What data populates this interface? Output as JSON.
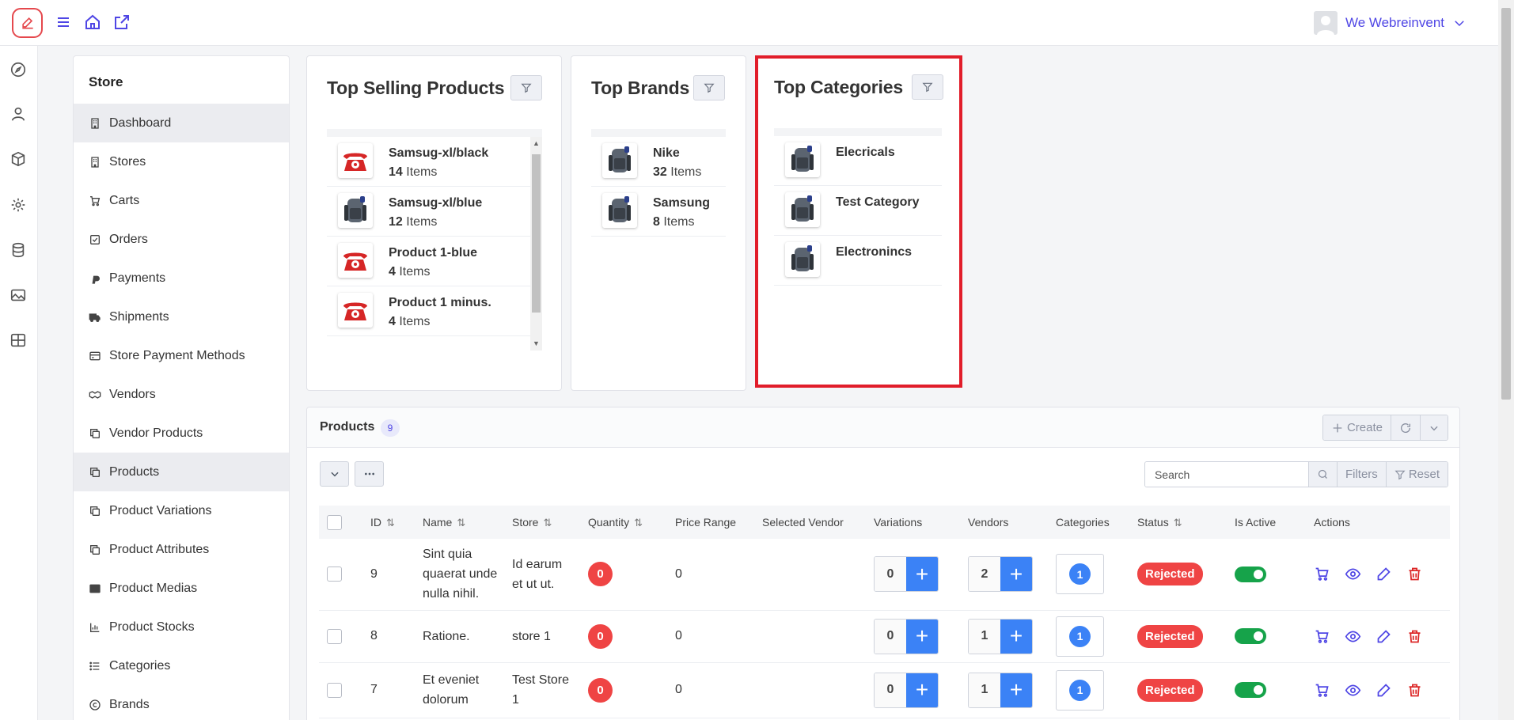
{
  "topbar": {
    "user_name": "We Webreinvent"
  },
  "sidebar": {
    "title": "Store",
    "items": [
      {
        "label": "Dashboard",
        "icon": "building-icon"
      },
      {
        "label": "Stores",
        "icon": "building-icon"
      },
      {
        "label": "Carts",
        "icon": "cart-icon"
      },
      {
        "label": "Orders",
        "icon": "check-square-icon"
      },
      {
        "label": "Payments",
        "icon": "paypal-icon"
      },
      {
        "label": "Shipments",
        "icon": "truck-icon"
      },
      {
        "label": "Store Payment Methods",
        "icon": "credit-card-icon"
      },
      {
        "label": "Vendors",
        "icon": "handshake-icon"
      },
      {
        "label": "Vendor Products",
        "icon": "copy-icon"
      },
      {
        "label": "Products",
        "icon": "copy-icon"
      },
      {
        "label": "Product Variations",
        "icon": "copy-icon"
      },
      {
        "label": "Product Attributes",
        "icon": "copy-icon"
      },
      {
        "label": "Product Medias",
        "icon": "image-icon"
      },
      {
        "label": "Product Stocks",
        "icon": "chart-icon"
      },
      {
        "label": "Categories",
        "icon": "list-icon"
      },
      {
        "label": "Brands",
        "icon": "copyright-icon"
      }
    ]
  },
  "top_selling": {
    "title": "Top Selling Products",
    "items": [
      {
        "name": "Samsug-xl/black",
        "count": "14",
        "unit": "Items",
        "thumb": "phone"
      },
      {
        "name": "Samsug-xl/blue",
        "count": "12",
        "unit": "Items",
        "thumb": "backpack"
      },
      {
        "name": "Product 1-blue",
        "count": "4",
        "unit": "Items",
        "thumb": "phone"
      },
      {
        "name": "Product 1 minus.",
        "count": "4",
        "unit": "Items",
        "thumb": "phone"
      }
    ]
  },
  "top_brands": {
    "title": "Top Brands",
    "items": [
      {
        "name": "Nike",
        "count": "32",
        "unit": "Items"
      },
      {
        "name": "Samsung",
        "count": "8",
        "unit": "Items"
      }
    ]
  },
  "top_categories": {
    "title": "Top Categories",
    "items": [
      {
        "name": "Elecricals"
      },
      {
        "name": "Test Category"
      },
      {
        "name": "Electronincs"
      }
    ]
  },
  "products": {
    "title": "Products",
    "count": "9",
    "create_label": "Create",
    "search_placeholder": "Search",
    "filters_label": "Filters",
    "reset_label": "Reset",
    "columns": [
      "ID",
      "Name",
      "Store",
      "Quantity",
      "Price Range",
      "Selected Vendor",
      "Variations",
      "Vendors",
      "Categories",
      "Status",
      "Is Active",
      "Actions"
    ],
    "rows": [
      {
        "id": "9",
        "name": "Sint quia quaerat unde nulla nihil.",
        "store": "Id earum et ut ut.",
        "quantity": "0",
        "price_range": "0",
        "variations": "0",
        "vendors": "2",
        "categories": "1",
        "status": "Rejected"
      },
      {
        "id": "8",
        "name": "Ratione.",
        "store": "store 1",
        "quantity": "0",
        "price_range": "0",
        "variations": "0",
        "vendors": "1",
        "categories": "1",
        "status": "Rejected"
      },
      {
        "id": "7",
        "name": "Et eveniet dolorum",
        "store": "Test Store 1",
        "quantity": "0",
        "price_range": "0",
        "variations": "0",
        "vendors": "1",
        "categories": "1",
        "status": "Rejected"
      }
    ]
  },
  "colors": {
    "accent": "#4f46e5",
    "danger": "#ef4444",
    "primary": "#3b82f6",
    "success": "#16a34a",
    "highlight": "#e11d2a"
  }
}
